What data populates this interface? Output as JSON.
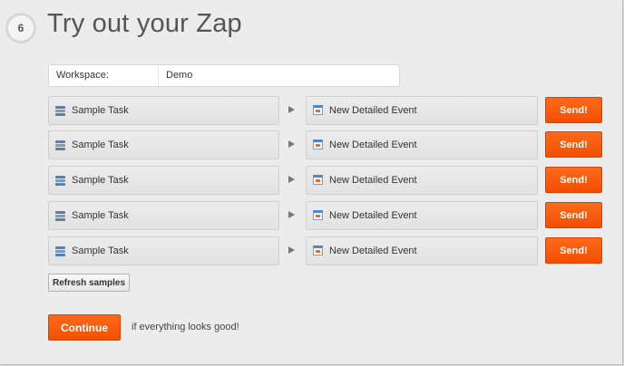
{
  "step": {
    "number": "6"
  },
  "title": "Try out your Zap",
  "workspace": {
    "label": "Workspace:",
    "value": "Demo"
  },
  "rows": [
    {
      "trigger": "Sample Task",
      "action": "New Detailed Event",
      "send_label": "Send!"
    },
    {
      "trigger": "Sample Task",
      "action": "New Detailed Event",
      "send_label": "Send!"
    },
    {
      "trigger": "Sample Task",
      "action": "New Detailed Event",
      "send_label": "Send!"
    },
    {
      "trigger": "Sample Task",
      "action": "New Detailed Event",
      "send_label": "Send!"
    },
    {
      "trigger": "Sample Task",
      "action": "New Detailed Event",
      "send_label": "Send!"
    }
  ],
  "refresh_label": "Refresh samples",
  "continue_label": "Continue",
  "continue_hint": "if everything looks good!",
  "colors": {
    "accent": "#f65a0a",
    "background": "#ececec",
    "title": "#555555"
  },
  "icons": {
    "trigger": "task-list-icon",
    "action": "calendar-icon",
    "arrow": "play-arrow-icon"
  }
}
